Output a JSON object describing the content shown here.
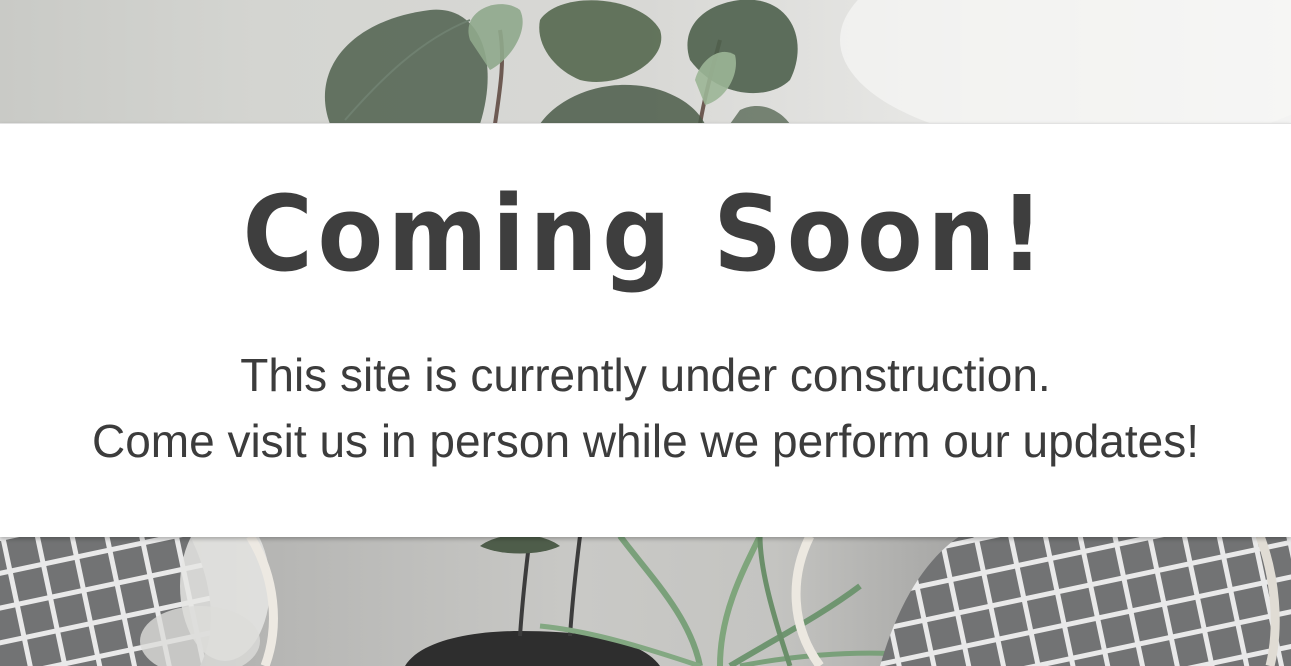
{
  "page": {
    "headline": "Coming Soon!",
    "line1": "This site is currently under construction.",
    "line2": "Come visit us in person while we perform our updates!"
  },
  "images": {
    "top": "plant-leaves-photo",
    "bottom": "plant-pot-with-cushions-photo"
  },
  "colors": {
    "text": "#3e3e3e",
    "banner": "#ffffff",
    "leaf": "#5d6e5c",
    "cushion": "#7d7d7e"
  }
}
